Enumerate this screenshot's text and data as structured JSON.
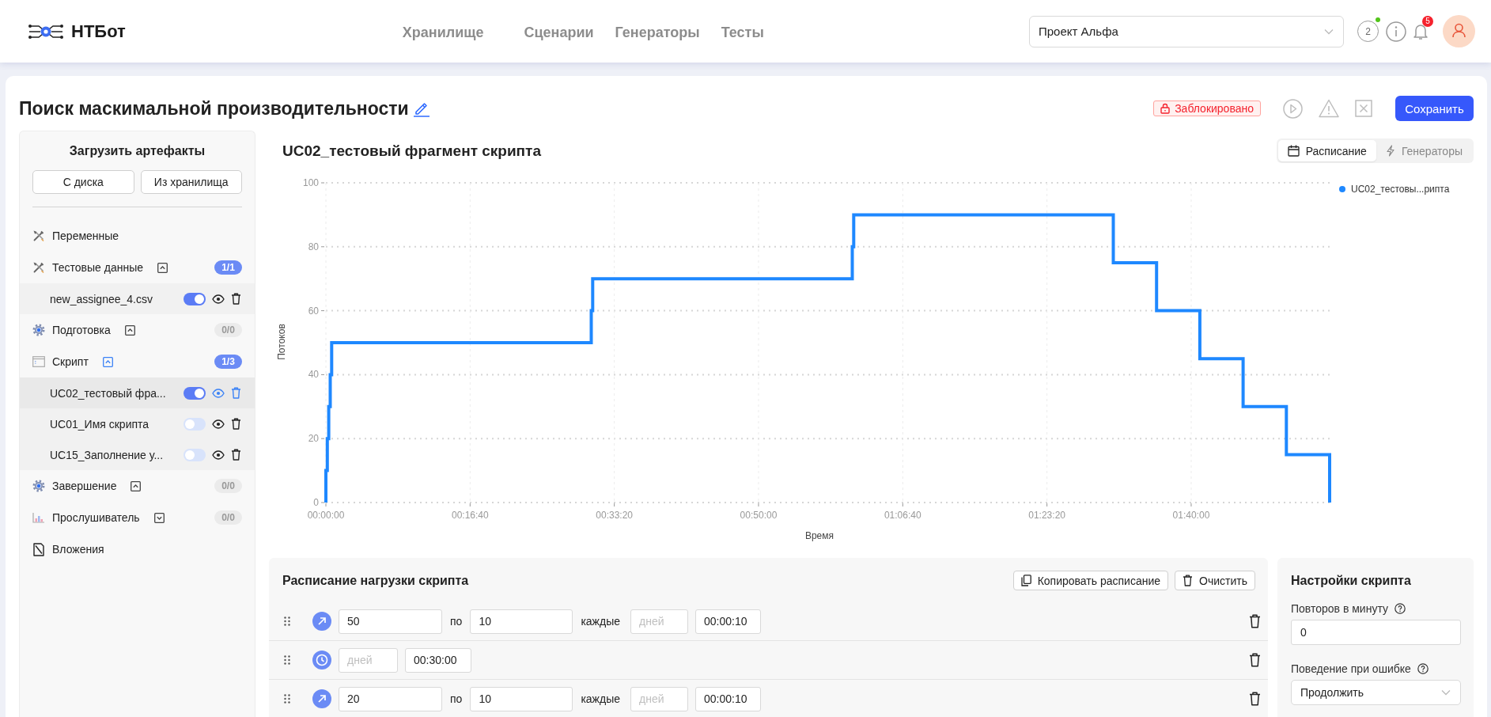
{
  "header": {
    "logo": "НТБот",
    "nav": [
      {
        "label": "Хранилище",
        "selected": false
      },
      {
        "label": "Сценарии",
        "selected": false
      },
      {
        "label": "Генераторы",
        "selected": false
      },
      {
        "label": "Тесты",
        "selected": false
      }
    ],
    "project_select": {
      "value": "Проект Альфа"
    },
    "counter": "2",
    "notifications": "5"
  },
  "page": {
    "title": "Поиск маскимальной производительности",
    "status_badge": "Заблокировано",
    "actions": [
      {
        "kind": "run",
        "disabled": true
      },
      {
        "kind": "warnings",
        "disabled": true
      },
      {
        "kind": "stop",
        "disabled": true
      }
    ],
    "save_button": "Сохранить"
  },
  "sidebar": {
    "title": "Загрузить артефакты",
    "upload_buttons": [
      "С диска",
      "Из хранилища"
    ],
    "items": [
      {
        "kind": "variables",
        "label": "Переменные",
        "selected": false
      },
      {
        "kind": "data",
        "label": "Тестовые данные",
        "selected": false,
        "expanded": true,
        "count": "1/1",
        "count_active": true,
        "children": [
          {
            "label": "new_assignee_4.csv",
            "enabled": true,
            "selected": false
          }
        ]
      },
      {
        "kind": "setup",
        "label": "Подготовка",
        "selected": false,
        "expanded": true,
        "count": "0/0",
        "count_active": false
      },
      {
        "kind": "script",
        "label": "Скрипт",
        "selected": true,
        "expanded": true,
        "count": "1/3",
        "count_active": true,
        "children": [
          {
            "label": "UC02_тестовый фра...",
            "enabled": true,
            "selected": true
          },
          {
            "label": "UC01_Имя скрипта",
            "enabled": false,
            "selected": false
          },
          {
            "label": "UC15_Заполнение у...",
            "enabled": false,
            "selected": false
          }
        ]
      },
      {
        "kind": "teardown",
        "label": "Завершение",
        "selected": false,
        "expanded": true,
        "count": "0/0",
        "count_active": false
      },
      {
        "kind": "listener",
        "label": "Прослушиватель",
        "selected": false,
        "expanded": false,
        "count": "0/0",
        "count_active": false
      },
      {
        "kind": "attachments",
        "label": "Вложения",
        "selected": false
      }
    ]
  },
  "chart_panel": {
    "title": "UC02_тестовый фрагмент скрипта",
    "view_tabs": [
      {
        "kind": "schedule",
        "label": "Расписание",
        "selected": true
      },
      {
        "kind": "generators",
        "label": "Генераторы",
        "selected": false
      }
    ],
    "chart_data": {
      "type": "line",
      "xlabel": "Время",
      "ylabel": "Потоков",
      "grid": true,
      "x": [
        0,
        0,
        10,
        10,
        20,
        20,
        30,
        30,
        40,
        40,
        1840,
        1840,
        1850,
        1850,
        3650,
        3650,
        3660,
        3660,
        5460,
        5460,
        5760,
        5760,
        6060,
        6060,
        6360,
        6360,
        6660,
        6660,
        6960,
        6960
      ],
      "series": [
        {
          "name": "UC02_тестовы...рипта",
          "color": "#1e88ff",
          "values": [
            0,
            10,
            10,
            20,
            20,
            30,
            30,
            40,
            40,
            50,
            50,
            60,
            60,
            70,
            70,
            80,
            80,
            90,
            90,
            75,
            75,
            60,
            60,
            45,
            45,
            30,
            30,
            15,
            15,
            0
          ]
        }
      ],
      "xlim": [
        0,
        6960
      ],
      "ylim": [
        0,
        100
      ],
      "xticks": [
        {
          "value": 0,
          "label": "00:00:00"
        },
        {
          "value": 1000,
          "label": "00:16:40"
        },
        {
          "value": 2000,
          "label": "00:33:20"
        },
        {
          "value": 3000,
          "label": "00:50:00"
        },
        {
          "value": 4000,
          "label": "01:06:40"
        },
        {
          "value": 5000,
          "label": "01:23:20"
        },
        {
          "value": 6000,
          "label": "01:40:00"
        }
      ],
      "yticks": [
        0,
        20,
        40,
        60,
        80,
        100
      ]
    }
  },
  "schedule": {
    "title": "Расписание нагрузки скрипта",
    "buttons": [
      {
        "kind": "copy",
        "label": "Копировать расписание"
      },
      {
        "kind": "clear",
        "label": "Очистить"
      }
    ],
    "rows": [
      {
        "kind": "ramp",
        "count": "50",
        "by_label": "по",
        "step": "10",
        "every_label": "каждые",
        "days": {
          "placeholder": "дней"
        },
        "time": "00:00:10"
      },
      {
        "kind": "hold",
        "days": {
          "placeholder": "дней"
        },
        "time": "00:30:00"
      },
      {
        "kind": "ramp",
        "count": "20",
        "by_label": "по",
        "step": "10",
        "every_label": "каждые",
        "days": {
          "placeholder": "дней"
        },
        "time": "00:00:10"
      }
    ]
  },
  "settings": {
    "title": "Настройки скрипта",
    "fields": [
      {
        "kind": "input",
        "label": "Повторов в минуту",
        "value": "0"
      },
      {
        "kind": "select",
        "label": "Поведение при ошибке",
        "value": "Продолжить"
      }
    ]
  }
}
